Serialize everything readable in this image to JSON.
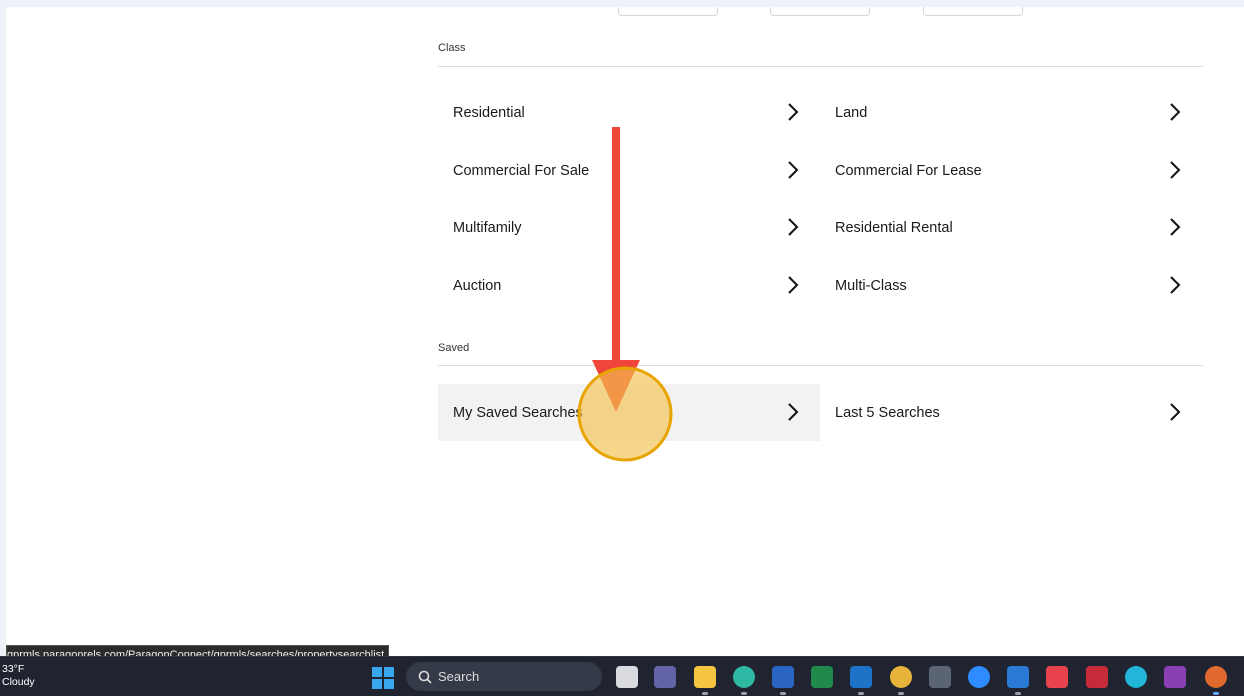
{
  "sections": {
    "class_label": "Class",
    "saved_label": "Saved"
  },
  "class_items": [
    {
      "label": "Residential"
    },
    {
      "label": "Land"
    },
    {
      "label": "Commercial For Sale"
    },
    {
      "label": "Commercial For Lease"
    },
    {
      "label": "Multifamily"
    },
    {
      "label": "Residential Rental"
    },
    {
      "label": "Auction"
    },
    {
      "label": "Multi-Class"
    }
  ],
  "saved_items": [
    {
      "label": "My Saved Searches"
    },
    {
      "label": "Last 5 Searches"
    }
  ],
  "status_url": "gprmls.paragonrels.com/ParagonConnect/gprmls/searches/propertysearchlist",
  "taskbar": {
    "weather_temp": "33°F",
    "weather_desc": "Cloudy",
    "search_label": "Search",
    "apps": [
      "task-view-icon",
      "teams-icon",
      "file-explorer-icon",
      "edge-icon",
      "word-icon",
      "excel-icon",
      "outlook-icon",
      "chrome-icon",
      "calculator-icon",
      "zoom-icon",
      "remine-icon",
      "todoist-icon",
      "app-red-icon",
      "canva-icon",
      "onenote-icon",
      "chrome-profile-icon"
    ]
  },
  "colors": {
    "accent_arrow": "#f0453a",
    "highlight_circle": "#f2c14e",
    "taskbar_bg": "#1f2430"
  }
}
